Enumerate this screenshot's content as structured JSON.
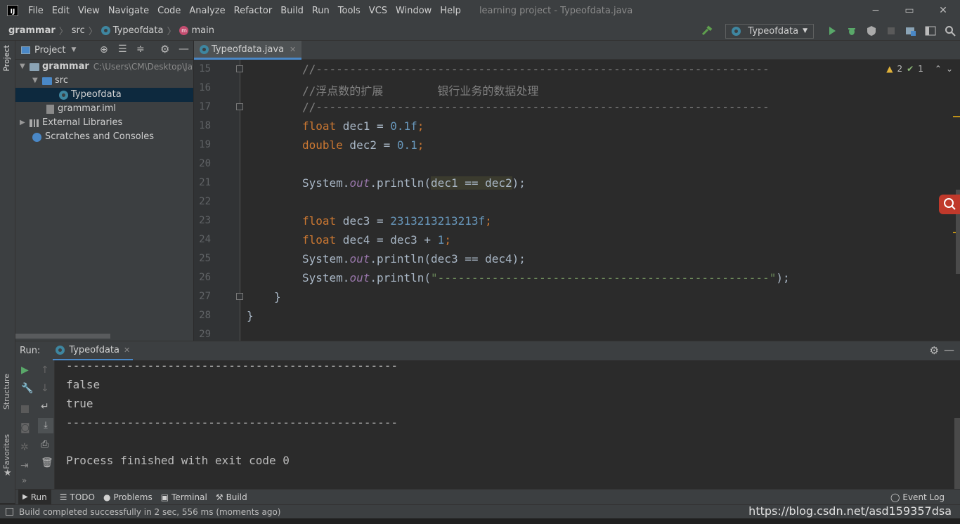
{
  "titlebar": {
    "logo": "IJ",
    "menu": [
      "File",
      "Edit",
      "View",
      "Navigate",
      "Code",
      "Analyze",
      "Refactor",
      "Build",
      "Run",
      "Tools",
      "VCS",
      "Window",
      "Help"
    ],
    "window_title": "learning project - Typeofdata.java",
    "minimize": "−",
    "maximize": "▭",
    "close": "✕"
  },
  "navbar": {
    "crumbs": [
      "grammar",
      "src",
      "Typeofdata",
      "main"
    ],
    "run_config": "Typeofdata"
  },
  "left_strip": {
    "project_label": "Project",
    "structure_label": "Structure",
    "favorites_label": "Favorites"
  },
  "project": {
    "header": "Project",
    "tree": [
      {
        "label": "grammar",
        "path": "C:\\Users\\CM\\Desktop\\Jav"
      },
      {
        "label": "src"
      },
      {
        "label": "Typeofdata"
      },
      {
        "label": "grammar.iml"
      },
      {
        "label": "External Libraries"
      },
      {
        "label": "Scratches and Consoles"
      }
    ]
  },
  "editor": {
    "tab": "Typeofdata.java",
    "warnings": "2",
    "weak_warnings": "1",
    "line_numbers": [
      "15",
      "16",
      "17",
      "18",
      "19",
      "20",
      "21",
      "22",
      "23",
      "24",
      "25",
      "26",
      "27",
      "28",
      "29"
    ],
    "lines": {
      "l15": "//-------------------------------------------------------------------",
      "l16": "//浮点数的扩展        银行业务的数据处理",
      "l17": "//-------------------------------------------------------------------",
      "l18_kw": "float",
      "l18_a": " dec1 = ",
      "l18_n": "0.1f",
      "l18_b": ";",
      "l19_kw": "double",
      "l19_a": " dec2 = ",
      "l19_n": "0.1",
      "l19_b": ";",
      "l21_a": "System.",
      "l21_out": "out",
      "l21_b": ".println(",
      "l21_hl": "dec1 == dec2",
      "l21_c": ");",
      "l23_kw": "float",
      "l23_a": " dec3 = ",
      "l23_n": "2313213213213f",
      "l23_b": ";",
      "l24_kw": "float",
      "l24_a": " dec4 = dec3 + ",
      "l24_n": "1",
      "l24_b": ";",
      "l25_a": "System.",
      "l25_out": "out",
      "l25_b": ".println(dec3 == dec4);",
      "l26_a": "System.",
      "l26_out": "out",
      "l26_b": ".println(",
      "l26_s": "\"-------------------------------------------------\"",
      "l26_c": ");",
      "l27": "}",
      "l28": "}"
    }
  },
  "run": {
    "label": "Run:",
    "tab": "Typeofdata",
    "output": [
      "-------------------------------------------------",
      "false",
      "true",
      "-------------------------------------------------",
      "",
      "Process finished with exit code 0"
    ]
  },
  "bottom_tabs": [
    "Run",
    "TODO",
    "Problems",
    "Terminal",
    "Build"
  ],
  "event_log": "Event Log",
  "status": "Build completed successfully in 2 sec, 556 ms (moments ago)",
  "watermark": "https://blog.csdn.net/asd159357dsa"
}
